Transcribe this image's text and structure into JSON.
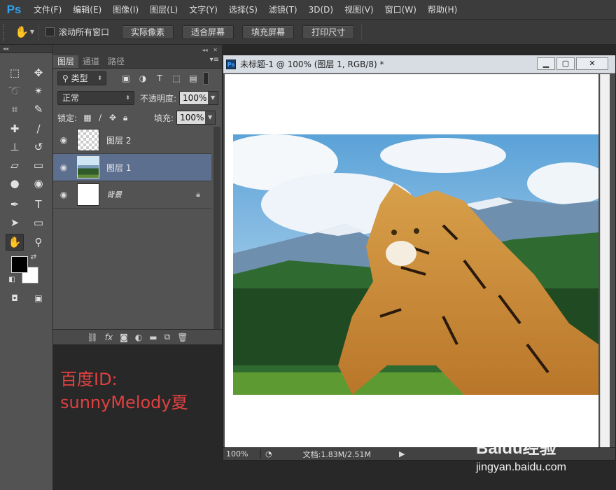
{
  "app": {
    "logo": "Ps"
  },
  "menu": [
    "文件(F)",
    "编辑(E)",
    "图像(I)",
    "图层(L)",
    "文字(Y)",
    "选择(S)",
    "滤镜(T)",
    "3D(D)",
    "视图(V)",
    "窗口(W)",
    "帮助(H)"
  ],
  "options": {
    "scroll_all_label": "滚动所有窗口",
    "btn_actual": "实际像素",
    "btn_fit": "适合屏幕",
    "btn_fill": "填充屏幕",
    "btn_print": "打印尺寸"
  },
  "tools": [
    "marquee-icon",
    "move-icon",
    "lasso-icon",
    "magic-wand-icon",
    "crop-icon",
    "eyedropper-icon",
    "healing-brush-icon",
    "brush-icon",
    "stamp-icon",
    "history-brush-icon",
    "eraser-icon",
    "gradient-icon",
    "blur-icon",
    "dodge-icon",
    "pen-icon",
    "type-icon",
    "path-select-icon",
    "shape-icon",
    "hand-icon",
    "zoom-icon"
  ],
  "panel": {
    "tabs": [
      "图层",
      "通道",
      "路径"
    ],
    "filter_kind": "类型",
    "blend_mode": "正常",
    "opacity_label": "不透明度:",
    "opacity_value": "100%",
    "lock_label": "锁定:",
    "fill_label": "填充:",
    "fill_value": "100%",
    "layers": [
      {
        "name": "图层 2",
        "thumb": "checker",
        "selected": false
      },
      {
        "name": "图层 1",
        "thumb": "land",
        "selected": true
      },
      {
        "name": "背景",
        "thumb": "white",
        "selected": false,
        "locked": true
      }
    ]
  },
  "watermark": {
    "line1": "百度ID:",
    "line2": "sunnyMelody夏"
  },
  "document": {
    "title": "未标题-1 @ 100% (图层 1, RGB/8) *",
    "zoom": "100%",
    "doc_info": "文档:1.83M/2.51M"
  },
  "brand": {
    "logo": "Baidu经验",
    "url": "jingyan.baidu.com"
  }
}
